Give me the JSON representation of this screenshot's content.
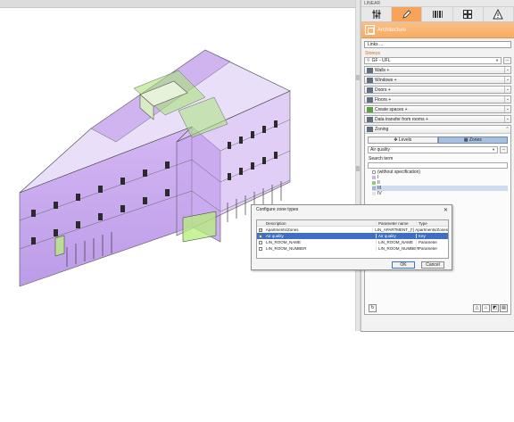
{
  "app": {
    "panel_title": "LINEAR"
  },
  "tabs": [
    {
      "icon": "sliders-icon",
      "active": false
    },
    {
      "icon": "pencil-icon",
      "active": true
    },
    {
      "icon": "barcode-icon",
      "active": false
    },
    {
      "icon": "grid-icon",
      "active": false
    },
    {
      "icon": "warning-icon",
      "active": false
    }
  ],
  "header": {
    "title": "Architecture"
  },
  "links_label": "Links ...",
  "storeys": {
    "label": "Storeys",
    "value": "GF - UFL",
    "more": "..."
  },
  "sections": [
    {
      "label": "Walls +"
    },
    {
      "label": "Windows +"
    },
    {
      "label": "Doors +"
    },
    {
      "label": "Floors +"
    },
    {
      "label": "Create spaces +"
    },
    {
      "label": "Data transfer from rooms +"
    }
  ],
  "zoning": {
    "label": "Zoning",
    "btn_levels": "Levels",
    "btn_zones": "Zones",
    "zone_value": "Air quality",
    "more": "...",
    "search_label": "Search term",
    "tree": [
      {
        "label": "(without specification)",
        "color": "#ffffff"
      },
      {
        "label": "I",
        "color": "#c9b7e6"
      },
      {
        "label": "II",
        "color": "#8fcf6c"
      },
      {
        "label": "III",
        "color": "#9bb9e2"
      },
      {
        "label": "IV",
        "color": "#e3e3e3"
      }
    ]
  },
  "dialog": {
    "title": "Configure zone types",
    "headers": {
      "desc": "Description",
      "param": "Parameter name",
      "type": "Type"
    },
    "rows": [
      {
        "checked": true,
        "desc": "Apartments/Zones",
        "param": "LIN_APARTMENT_(*)",
        "type": "Apartments/Zones",
        "selected": false
      },
      {
        "checked": true,
        "desc": "Air quality",
        "param": "Air quality",
        "type": "Key",
        "selected": true
      },
      {
        "checked": false,
        "desc": "LIN_ROOM_NAME",
        "param": "LIN_ROOM_NAME",
        "type": "Parameter",
        "selected": false
      },
      {
        "checked": false,
        "desc": "LIN_ROOM_NUMBER",
        "param": "LIN_ROOM_NUMBER",
        "type": "Parameter",
        "selected": false
      }
    ],
    "ok": "OK",
    "cancel": "Cancel"
  },
  "colors": {
    "accent": "#f8ac64",
    "selection": "#3f6fc4",
    "zone_purple": "#b07ae0",
    "zone_green": "#9ee26a"
  }
}
